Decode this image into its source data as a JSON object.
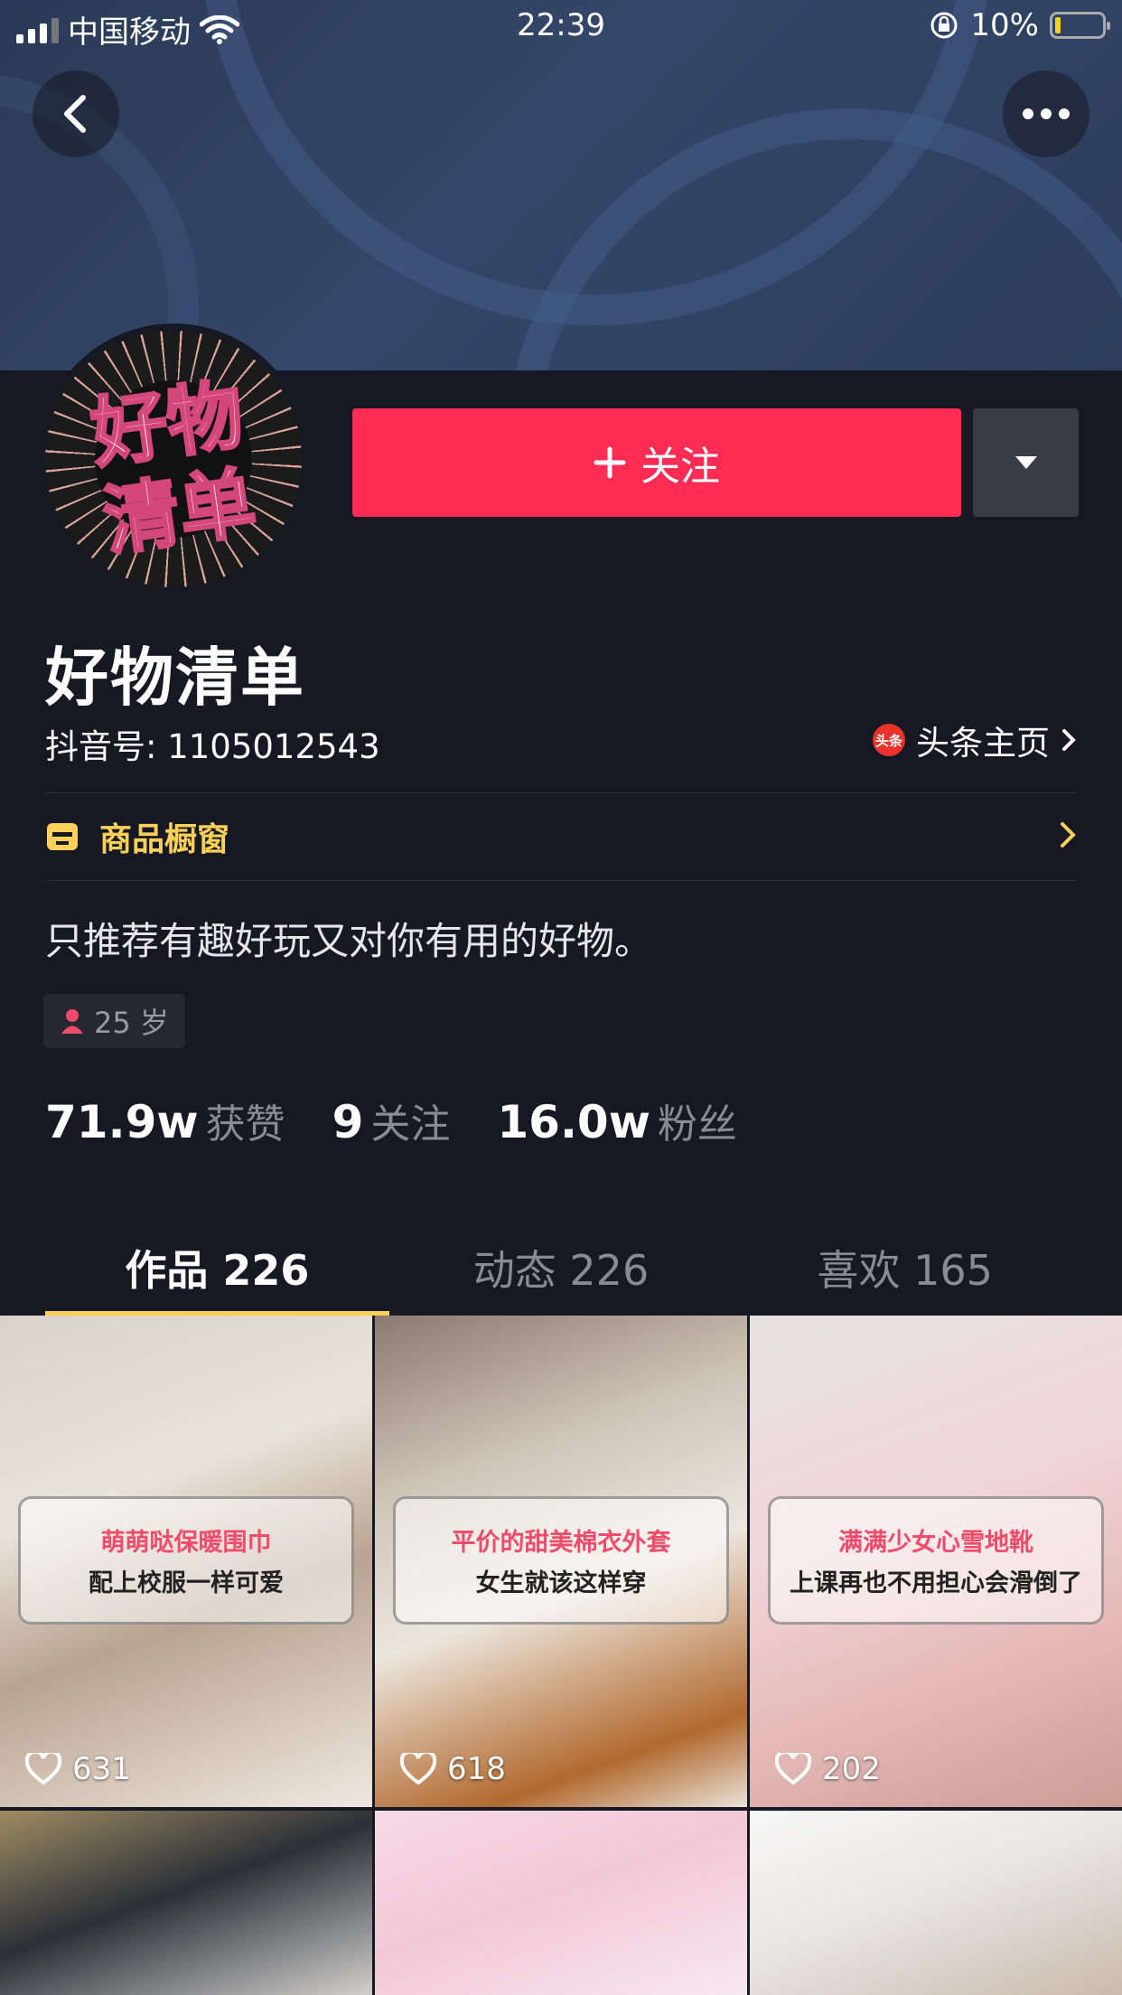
{
  "status_bar": {
    "carrier": "中国移动",
    "time": "22:39",
    "battery": "10%"
  },
  "colors": {
    "background": "#161823",
    "follow": "#fe2c55",
    "accent": "#facf5a"
  },
  "profile": {
    "avatar_text_line1": "好物",
    "avatar_text_line2": "清单",
    "follow_label": "关注",
    "name": "好物清单",
    "douyin_id": "抖音号: 1105012543",
    "toutiao_icon_text": "头条",
    "toutiao_link": "头条主页",
    "shop_label": "商品橱窗",
    "bio": "只推荐有趣好玩又对你有用的好物。",
    "age": "25 岁"
  },
  "stats": [
    {
      "value": "71.9w",
      "label": "获赞"
    },
    {
      "value": "9",
      "label": "关注"
    },
    {
      "value": "16.0w",
      "label": "粉丝"
    }
  ],
  "tabs": [
    {
      "label": "作品 226",
      "active": true
    },
    {
      "label": "动态 226",
      "active": false
    },
    {
      "label": "喜欢 165",
      "active": false
    }
  ],
  "videos": [
    {
      "caption1": "萌萌哒保暖围巾",
      "caption2": "配上校服一样可爱",
      "likes": "631"
    },
    {
      "caption1": "平价的甜美棉衣外套",
      "caption2": "女生就该这样穿",
      "likes": "618"
    },
    {
      "caption1": "满满少女心雪地靴",
      "caption2": "上课再也不用担心会滑倒了",
      "likes": "202"
    }
  ]
}
